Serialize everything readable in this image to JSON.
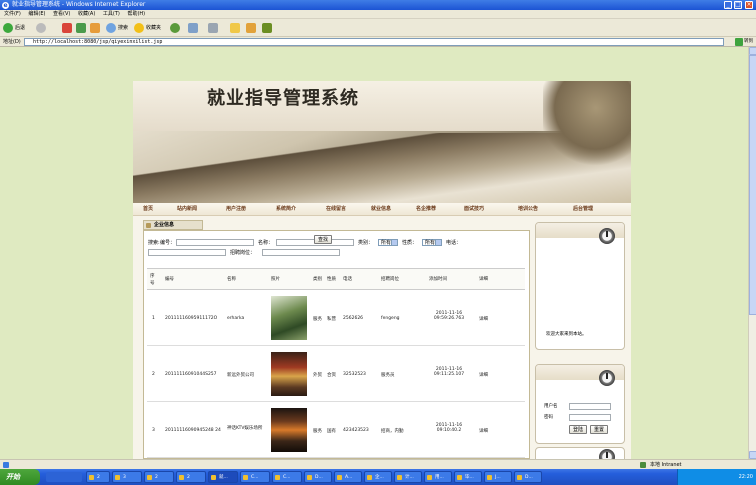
{
  "window": {
    "title": "就业指导管理系统 - Windows Internet Explorer"
  },
  "menu": [
    "文件(F)",
    "编辑(E)",
    "查看(V)",
    "收藏(A)",
    "工具(T)",
    "帮助(H)"
  ],
  "toolbar": {
    "back": "后退",
    "search": "搜索",
    "favorites": "收藏夹"
  },
  "address": {
    "label": "地址(D)",
    "url": "http://localhost:8080/jsp/qiyexinxilist.jsp",
    "go": "转到"
  },
  "site": {
    "title": "就业指导管理系统",
    "nav": [
      "首页",
      "站内新闻",
      "用户注册",
      "系统简介",
      "在线留言",
      "就业信息",
      "名企推荐",
      "面试技巧",
      "培训公告",
      "后台管理"
    ]
  },
  "panel": {
    "tab": "企业信息",
    "search": {
      "lead": "搜索:",
      "code_label": "编号：",
      "name_label": "名称：",
      "category_label": "类别：",
      "category_value": "所有",
      "nature_label": "性质：",
      "nature_value": "所有",
      "phone_label": "电话：",
      "position_label": "招聘岗位：",
      "button": "查找"
    },
    "headers": [
      "序号",
      "编号",
      "名称",
      "照片",
      "类别",
      "性质",
      "电话",
      "招聘岗位",
      "添加时间",
      "详细"
    ],
    "rows": [
      {
        "no": "1",
        "code": "20111116095911172O",
        "name": "erharka",
        "category": "服务",
        "nature": "私营",
        "phone": "2562626",
        "position": "fengeng",
        "time": "2011-11-16 09:59:26.763",
        "detail": "详细"
      },
      {
        "no": "2",
        "code": "20111116091044S257",
        "name": "新远外贸公司",
        "category": "外贸",
        "nature": "合资",
        "phone": "32532523",
        "position": "服务员",
        "time": "2011-11-16 09:11:25.107",
        "detail": "详细"
      },
      {
        "no": "3",
        "code": "20111116090945248 24",
        "name": "神话KTV娱乐场所",
        "category": "服务",
        "nature": "国有",
        "phone": "423423523",
        "position": "招商，内勤",
        "time": "2011-11-16 09:10:40.2",
        "detail": "详细"
      }
    ]
  },
  "sidebar": {
    "welcome": "欢迎大家来到本站。",
    "login": {
      "user_label": "用户名",
      "pass_label": "密码",
      "login_button": "登陆",
      "reset_button": "重置"
    }
  },
  "status": {
    "zone": "本地 Intranet"
  },
  "taskbar": {
    "start": "开始",
    "tasks": [
      "2",
      "3",
      "2",
      "2",
      "就...",
      "C...",
      "C...",
      "D...",
      "A...",
      "企...",
      "计...",
      "用...",
      "毕...",
      "J...",
      "D..."
    ],
    "clock": "22:20"
  }
}
